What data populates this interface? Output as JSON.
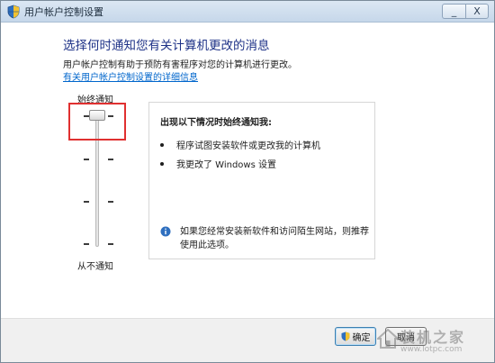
{
  "window": {
    "title": "用户帐户控制设置",
    "minimize_label": "_",
    "close_label": "X"
  },
  "content": {
    "heading": "选择何时通知您有关计算机更改的消息",
    "description": "用户帐户控制有助于预防有害程序对您的计算机进行更改。",
    "link": "有关用户帐户控制设置的详细信息"
  },
  "slider": {
    "top_label": "始终通知",
    "bottom_label": "从不通知",
    "level": 4,
    "level_count": 4
  },
  "panel": {
    "title": "出现以下情况时始终通知我:",
    "bullets": [
      "程序试图安装软件或更改我的计算机",
      "我更改了 Windows 设置"
    ],
    "info": "如果您经常安装新软件和访问陌生网站，则推荐使用此选项。"
  },
  "buttons": {
    "ok": "确定",
    "cancel": "取消"
  },
  "watermark": {
    "brand": "装机之家",
    "url": "www.lotpc.com"
  },
  "colors": {
    "heading": "#1e3287",
    "link": "#0066cc",
    "highlight": "#e03030"
  }
}
